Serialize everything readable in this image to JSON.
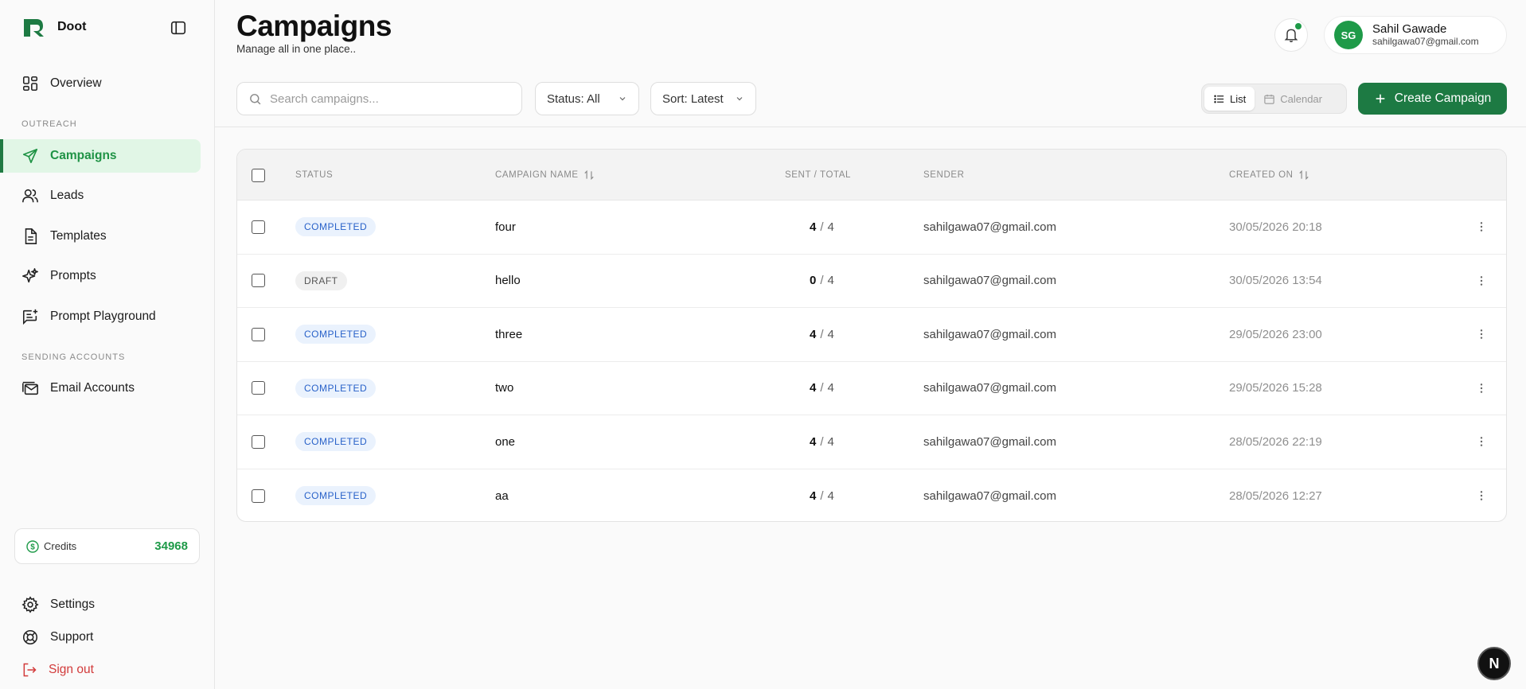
{
  "brand": {
    "name": "Doot"
  },
  "sidebar": {
    "items": [
      {
        "label": "Overview",
        "icon": "grid-icon"
      },
      {
        "label": "Campaigns",
        "icon": "send-icon",
        "active": true
      },
      {
        "label": "Leads",
        "icon": "users-icon"
      },
      {
        "label": "Templates",
        "icon": "document-icon"
      },
      {
        "label": "Prompts",
        "icon": "sparkles-icon"
      },
      {
        "label": "Prompt Playground",
        "icon": "chat-plus-icon"
      },
      {
        "label": "Email Accounts",
        "icon": "mail-stack-icon"
      }
    ],
    "sections": {
      "outreach": "OUTREACH",
      "sending_accounts": "SENDING ACCOUNTS"
    },
    "credits": {
      "label": "Credits",
      "value": "34968"
    },
    "bottom": {
      "settings": "Settings",
      "support": "Support",
      "signout": "Sign out"
    }
  },
  "header": {
    "title": "Campaigns",
    "subtitle": "Manage all in one place..",
    "user": {
      "initials": "SG",
      "name": "Sahil Gawade",
      "email": "sahilgawa07@gmail.com"
    }
  },
  "toolbar": {
    "search_placeholder": "Search campaigns...",
    "status_filter": "Status: All",
    "sort": "Sort: Latest",
    "view_list": "List",
    "view_calendar": "Calendar",
    "create_label": "Create Campaign"
  },
  "table": {
    "columns": {
      "status": "STATUS",
      "name": "CAMPAIGN NAME",
      "sent": "SENT / TOTAL",
      "sender": "SENDER",
      "created": "CREATED ON"
    },
    "rows": [
      {
        "status": "COMPLETED",
        "name": "four",
        "sent": "4",
        "total": "4",
        "sender": "sahilgawa07@gmail.com",
        "created": "30/05/2026 20:18"
      },
      {
        "status": "DRAFT",
        "name": "hello",
        "sent": "0",
        "total": "4",
        "sender": "sahilgawa07@gmail.com",
        "created": "30/05/2026 13:54"
      },
      {
        "status": "COMPLETED",
        "name": "three",
        "sent": "4",
        "total": "4",
        "sender": "sahilgawa07@gmail.com",
        "created": "29/05/2026 23:00"
      },
      {
        "status": "COMPLETED",
        "name": "two",
        "sent": "4",
        "total": "4",
        "sender": "sahilgawa07@gmail.com",
        "created": "29/05/2026 15:28"
      },
      {
        "status": "COMPLETED",
        "name": "one",
        "sent": "4",
        "total": "4",
        "sender": "sahilgawa07@gmail.com",
        "created": "28/05/2026 22:19"
      },
      {
        "status": "COMPLETED",
        "name": "aa",
        "sent": "4",
        "total": "4",
        "sender": "sahilgawa07@gmail.com",
        "created": "28/05/2026 12:27"
      }
    ]
  },
  "fab": {
    "label": "N"
  },
  "colors": {
    "accent": "#1d7a43",
    "accent_light": "#e1f6e6",
    "danger": "#d23a3a",
    "badge_blue": "#2962c9"
  }
}
